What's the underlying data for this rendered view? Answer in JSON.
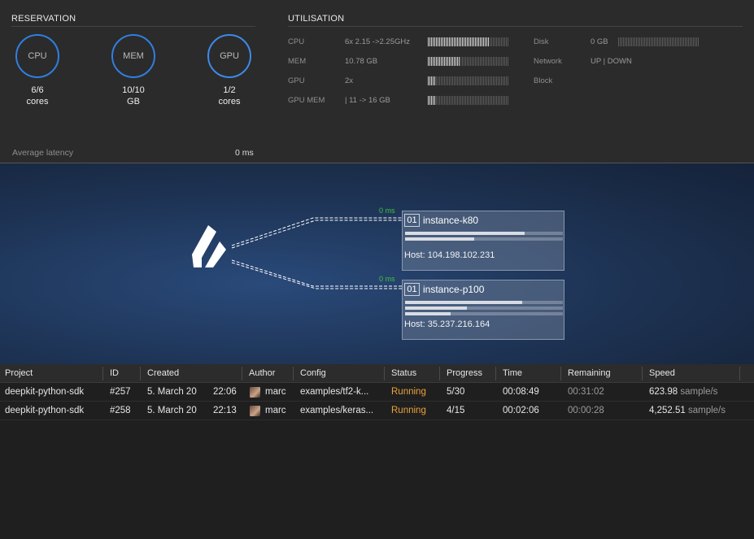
{
  "reservation": {
    "title": "RESERVATION",
    "gauges": [
      {
        "label": "CPU",
        "value": "6/6",
        "unit": "cores"
      },
      {
        "label": "MEM",
        "value": "10/10",
        "unit": "GB"
      },
      {
        "label": "GPU",
        "value": "1/2",
        "unit": "cores"
      }
    ]
  },
  "utilisation": {
    "title": "UTILISATION",
    "left": [
      {
        "label": "CPU",
        "value": "6x 2.15 ->2.25GHz",
        "level": 0.75
      },
      {
        "label": "MEM",
        "value": "10.78 GB",
        "level": 0.4
      },
      {
        "label": "GPU",
        "value": "2x",
        "level": 0.1
      },
      {
        "label": "GPU MEM",
        "value": "| 11 -> 16 GB",
        "level": 0.1
      }
    ],
    "right": [
      {
        "label": "Disk",
        "value": "0 GB",
        "level": 0
      },
      {
        "label": "Network",
        "value": "UP | DOWN"
      },
      {
        "label": "Block",
        "value": ""
      }
    ]
  },
  "latency": {
    "label": "Average latency",
    "value": "0 ms"
  },
  "instances": [
    {
      "num": "01",
      "name": "instance-k80",
      "host": "Host: 104.198.102.231",
      "latency": "0 ms",
      "bars": [
        0.76,
        0.44
      ]
    },
    {
      "num": "01",
      "name": "instance-p100",
      "host": "Host: 35.237.216.164",
      "latency": "0 ms",
      "bars": [
        0.74,
        0.39,
        0.29
      ]
    }
  ],
  "table": {
    "headers": [
      "Project",
      "ID",
      "Created",
      "Author",
      "Config",
      "Status",
      "Progress",
      "Time",
      "Remaining",
      "Speed"
    ],
    "rows": [
      {
        "project": "deepkit-python-sdk",
        "id": "#257",
        "date": "5. March 20",
        "time": "22:06",
        "author": "marc",
        "config": "examples/tf2-k...",
        "status": "Running",
        "progress": "5/30",
        "elapsed": "00:08:49",
        "remaining": "00:31:02",
        "speed": "623.98",
        "speed_unit": "sample/s"
      },
      {
        "project": "deepkit-python-sdk",
        "id": "#258",
        "date": "5. March 20",
        "time": "22:13",
        "author": "marc",
        "config": "examples/keras...",
        "status": "Running",
        "progress": "4/15",
        "elapsed": "00:02:06",
        "remaining": "00:00:28",
        "speed": "4,252.51",
        "speed_unit": "sample/s"
      }
    ]
  },
  "colors": {
    "accent": "#2f7fe0",
    "running": "#e8a33a",
    "latency": "#3fc23f"
  }
}
